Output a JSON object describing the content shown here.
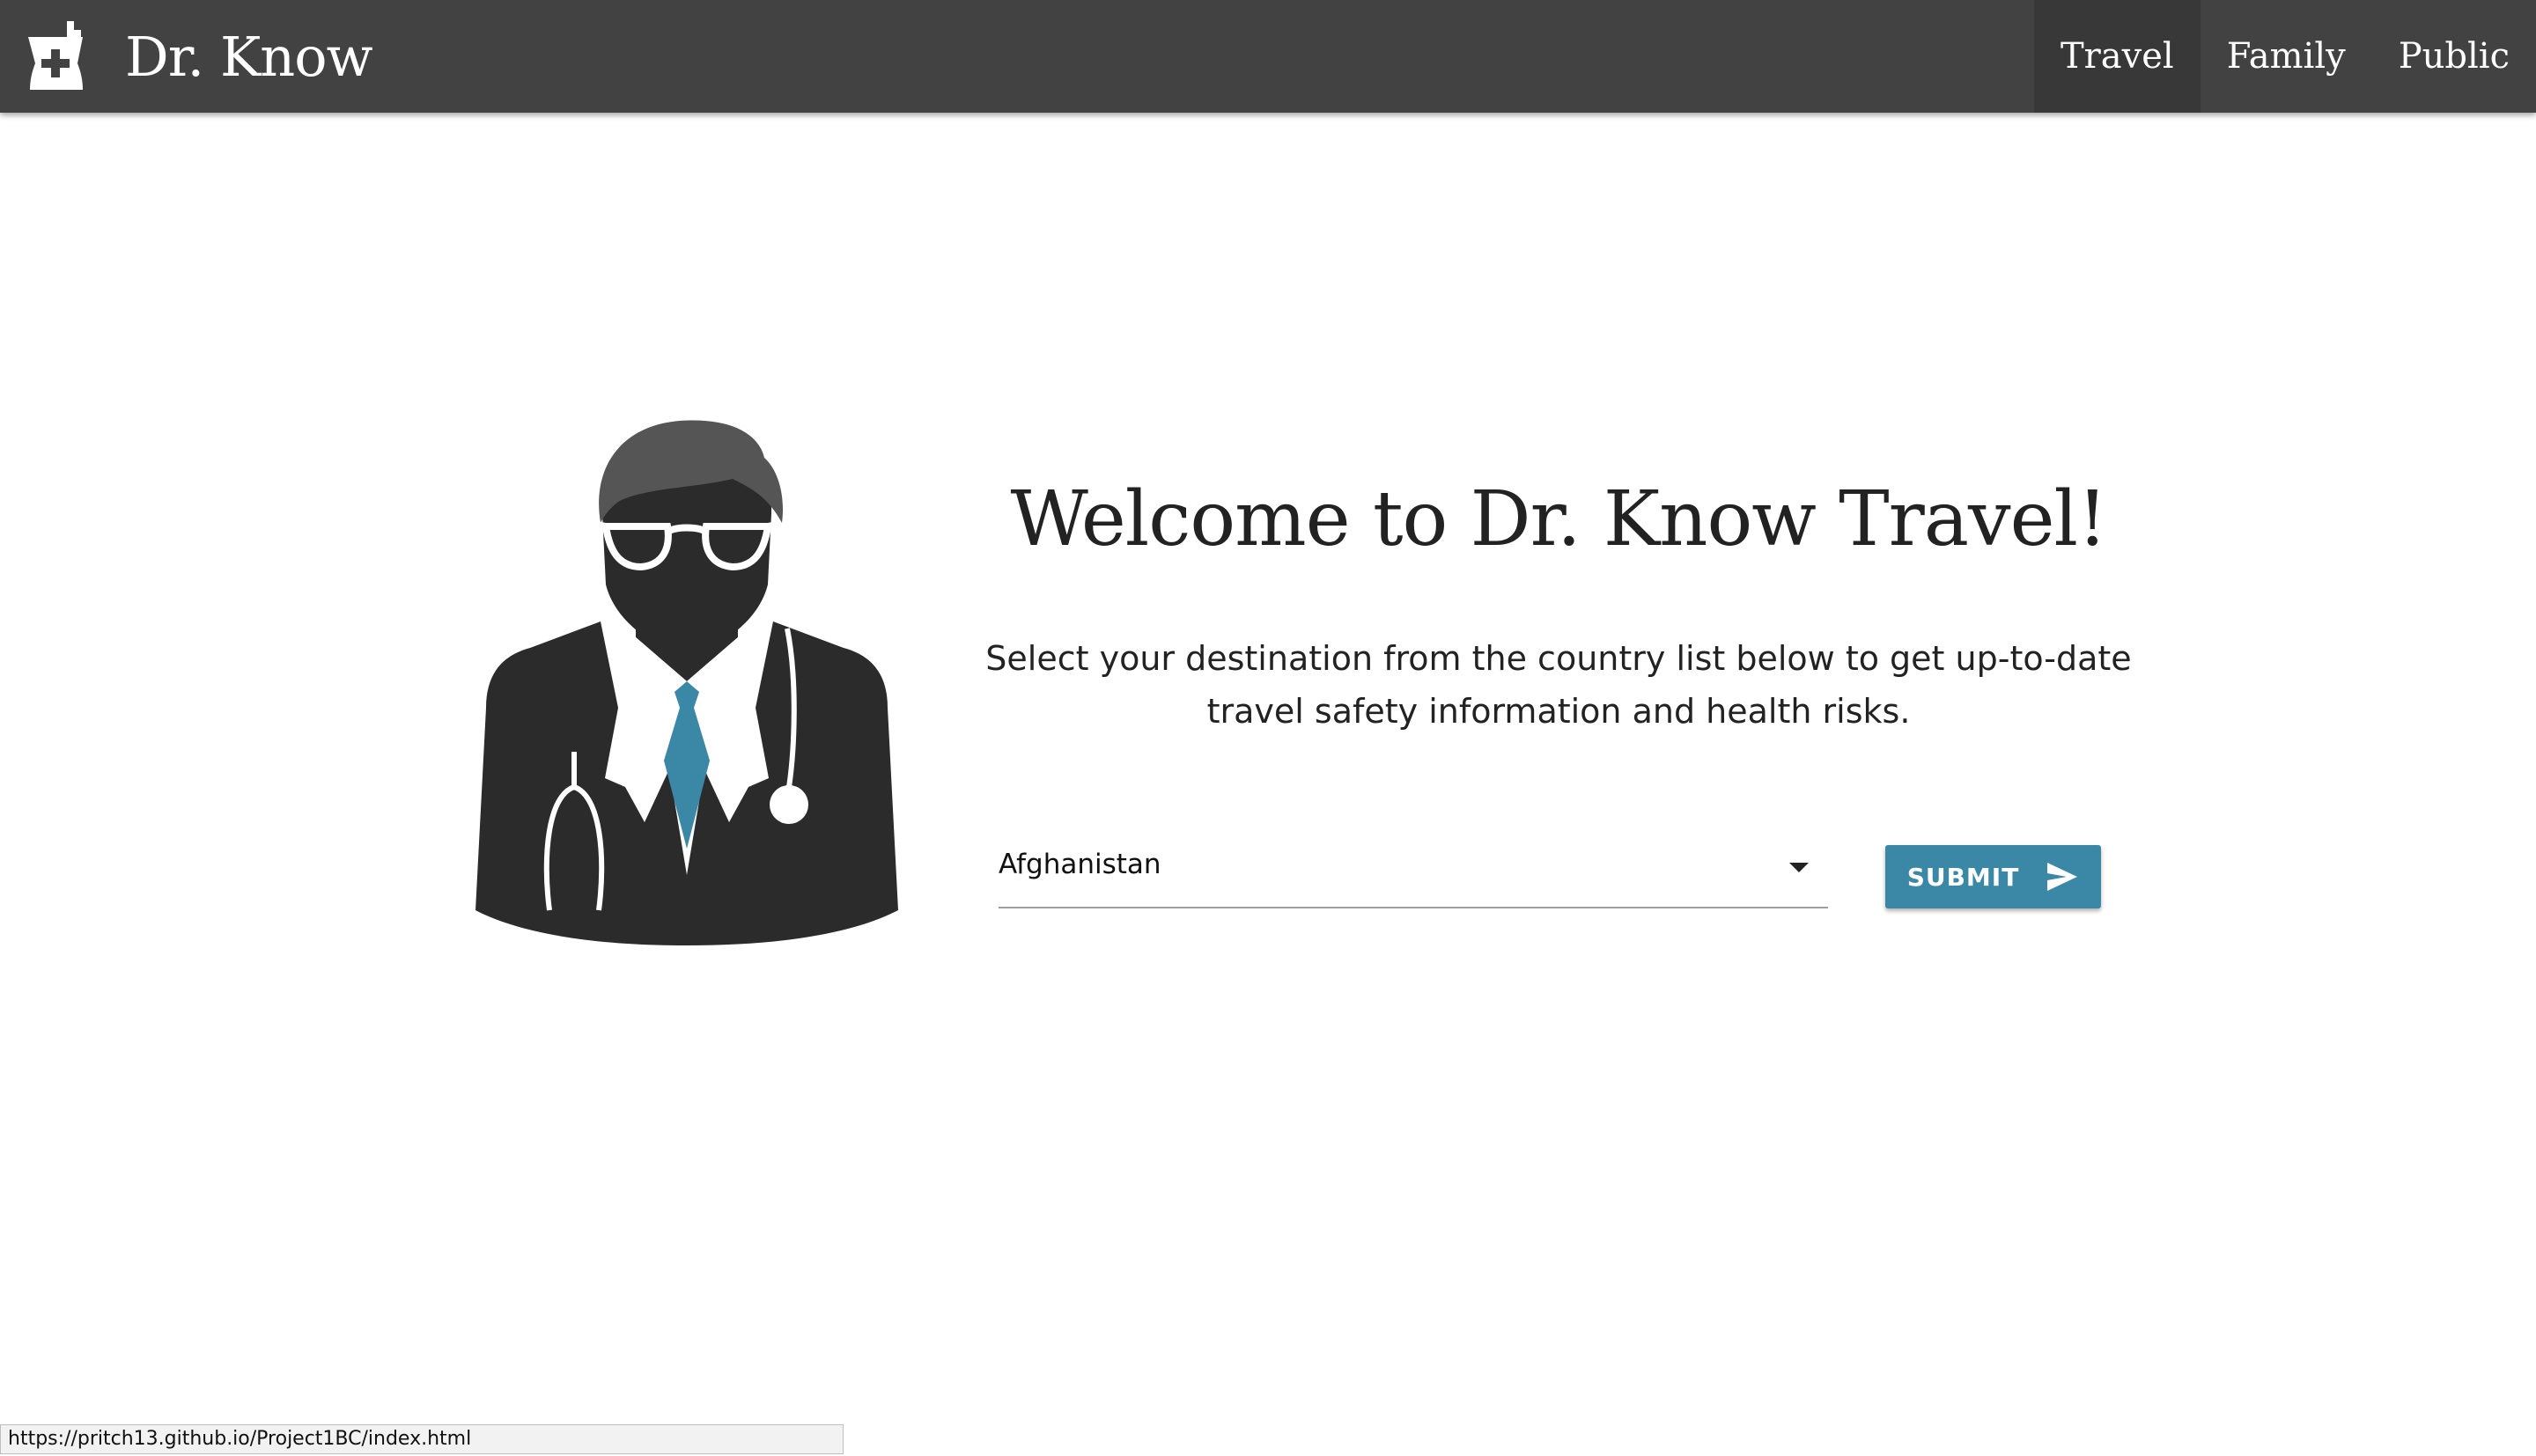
{
  "navbar": {
    "brand_icon": "mortar-pestle-plus-icon",
    "brand_title": "Dr. Know",
    "background_color": "#424242",
    "links": [
      {
        "label": "Travel",
        "active": true
      },
      {
        "label": "Family",
        "active": false
      },
      {
        "label": "Public",
        "active": false
      }
    ]
  },
  "hero": {
    "illustration": "doctor-icon",
    "title": "Welcome to Dr. Know Travel!",
    "intro": "Select your destination from the country list below to get up-to-date travel safety information and health risks."
  },
  "country_select": {
    "selected": "Afghanistan",
    "icon": "caret-down-icon"
  },
  "submit_button": {
    "label": "SUBMIT",
    "icon": "send-icon",
    "color": "#3a87a6"
  },
  "status_bar": {
    "url": "https://pritch13.github.io/Project1BC/index.html"
  },
  "colors": {
    "accent": "#3a87a6",
    "dark": "#2b2b2b"
  }
}
